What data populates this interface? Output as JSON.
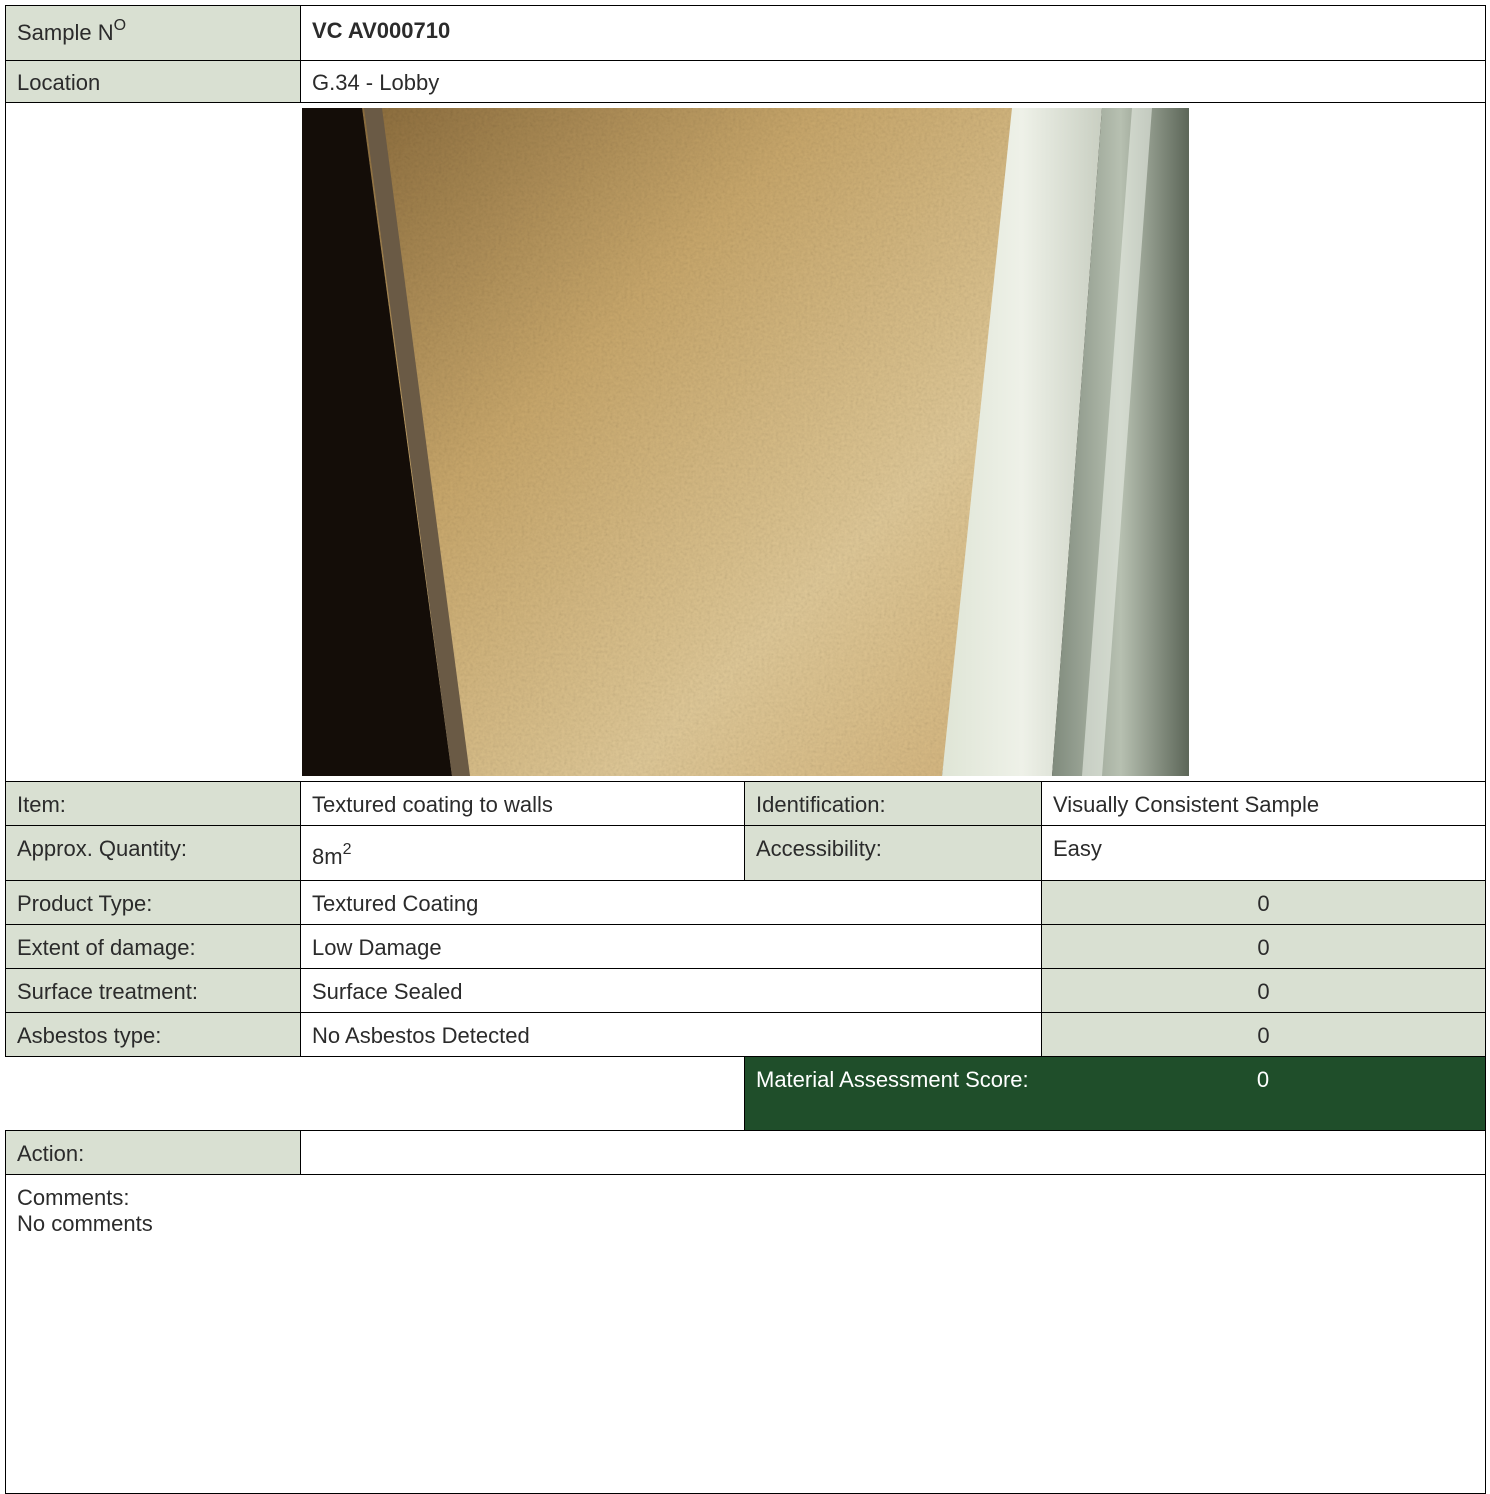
{
  "sample": {
    "label": "Sample N",
    "label_sup": "O",
    "value": "VC AV000710"
  },
  "location": {
    "label": "Location",
    "value": "G.34 - Lobby"
  },
  "photo": {
    "subject": "textured-wall-coating-photo"
  },
  "item": {
    "label": "Item:",
    "value": "Textured coating to walls"
  },
  "identification": {
    "label": "Identification:",
    "value": "Visually Consistent Sample"
  },
  "quantity": {
    "label": "Approx. Quantity:",
    "value": "8m",
    "value_sup": "2"
  },
  "accessibility": {
    "label": "Accessibility:",
    "value": "Easy"
  },
  "assessment_rows": [
    {
      "label": "Product Type:",
      "value": "Textured Coating",
      "score": "0"
    },
    {
      "label": "Extent of damage:",
      "value": "Low Damage",
      "score": "0"
    },
    {
      "label": "Surface treatment:",
      "value": "Surface Sealed",
      "score": "0"
    },
    {
      "label": "Asbestos type:",
      "value": "No Asbestos Detected",
      "score": "0"
    }
  ],
  "material_score": {
    "label": "Material Assessment Score:",
    "value": "0"
  },
  "action": {
    "label": "Action:",
    "value": ""
  },
  "comments": {
    "label": "Comments:",
    "value": "No comments"
  },
  "colors": {
    "label_bg": "#d9e0d2",
    "score_bg": "#1f4e2a",
    "border": "#000000"
  }
}
